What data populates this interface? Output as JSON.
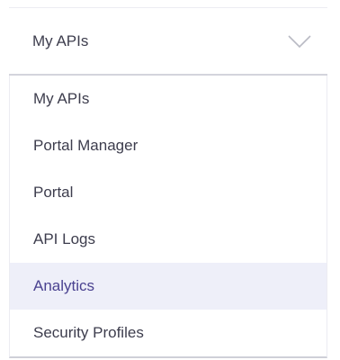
{
  "select": {
    "value": "My APIs",
    "icon": "chevron-down-icon"
  },
  "options": [
    {
      "label": "My APIs",
      "selected": false
    },
    {
      "label": "Portal Manager",
      "selected": false
    },
    {
      "label": "Portal",
      "selected": false
    },
    {
      "label": "API Logs",
      "selected": false
    },
    {
      "label": "Analytics",
      "selected": true
    },
    {
      "label": "Security Profiles",
      "selected": false
    }
  ],
  "colors": {
    "text": "#3d3d4d",
    "highlight_bg": "#eeeff9",
    "highlight_text": "#4a4290",
    "border": "#d3d4dc"
  }
}
